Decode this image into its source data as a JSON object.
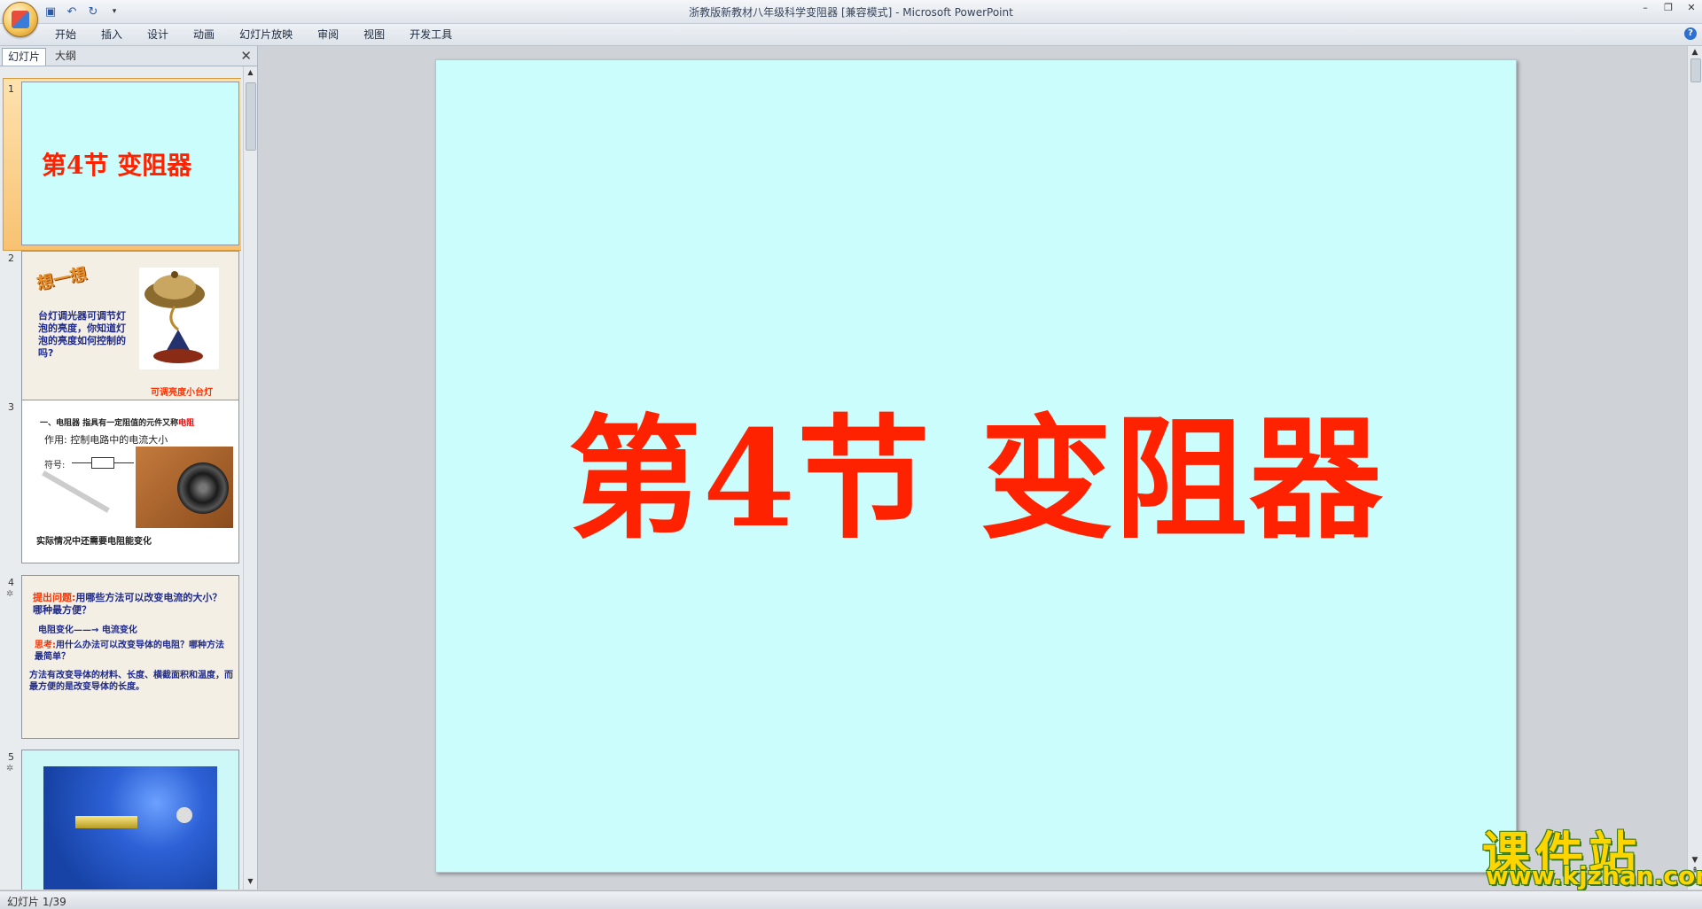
{
  "window": {
    "title": "浙教版新教材八年级科学变阻器 [兼容模式] - Microsoft PowerPoint",
    "controls": [
      "minimize-icon",
      "restore-icon",
      "close-icon"
    ]
  },
  "quick_access": [
    "save-icon",
    "undo-icon",
    "redo-icon",
    "customize-icon"
  ],
  "ribbon": {
    "tabs": [
      "开始",
      "插入",
      "设计",
      "动画",
      "幻灯片放映",
      "审阅",
      "视图",
      "开发工具"
    ]
  },
  "left_pane": {
    "tab_slides": "幻灯片",
    "tab_outline": "大纲",
    "slides": [
      {
        "number": "1",
        "title": "第4节  变阻器"
      },
      {
        "number": "2",
        "badge": "想一想",
        "text": "台灯调光器可调节灯泡的亮度，你知道灯泡的亮度如何控制的吗?",
        "caption": "可调亮度小台灯"
      },
      {
        "number": "3",
        "line1_prefix": "一、电阻器 指具有一定阻值的元件又称",
        "line1_red": "电阻",
        "line2": "作用: 控制电路中的电流大小",
        "line3": "符号:",
        "line4": "实际情况中还需要电阻能变化"
      },
      {
        "number": "4",
        "q_red": "提出问题:",
        "q_text": "用哪些方法可以改变电流的大小？哪种最方便？",
        "arrow": "电阻变化——→ 电流变化",
        "think_red": "思考:",
        "think_text": "用什么办法可以改变导体的电阻？哪种方法最简单？",
        "method": "方法有改变导体的材料、长度、横截面积和温度，而最方便的是改变导体的长度。"
      },
      {
        "number": "5"
      }
    ]
  },
  "slide": {
    "title": "第4节  变阻器"
  },
  "watermark": {
    "line1": "课件站",
    "line2": "www.kjzhan.com"
  },
  "status": {
    "slide_counter": "幻灯片 1/39"
  }
}
